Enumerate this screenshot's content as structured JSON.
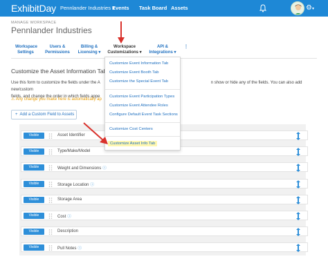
{
  "topbar": {
    "logo": "ExhibitDay",
    "org_selector": "Pennlander Industries",
    "nav": [
      "Events",
      "Task Board",
      "Assets"
    ]
  },
  "header": {
    "breadcrumb": "MANAGE WORKSPACE",
    "title": "Pennlander Industries"
  },
  "subnav": {
    "items": [
      {
        "line1": "Workspace",
        "line2": "Settings"
      },
      {
        "line1": "Users &",
        "line2": "Permissions"
      },
      {
        "line1": "Billing &",
        "line2": "Licensing"
      },
      {
        "line1": "Workspace",
        "line2": "Customizations"
      },
      {
        "line1": "API &",
        "line2": "Integrations"
      }
    ]
  },
  "dropdown": {
    "items": [
      "Customize Event Information Tab",
      "Customize Event Booth Tab",
      "Customize the Special Event Tab",
      "Customize Event Participation Types",
      "Customize Event Attendee Roles",
      "Configure Default Event Task Sections",
      "Customize Cost Centers",
      "Customize Asset Info Tab"
    ]
  },
  "main": {
    "section_title": "Customize the Asset Information Tab",
    "help_line1": "Use this form to customize the fields under the A",
    "help_line1_end": "n show or hide any of the fields. You can also add new/custom",
    "help_line2": "fields, and change the order in which fields appe",
    "warning": "Any change you make here is automatically ap",
    "add_button": "Add a Custom Field to Assets",
    "visible_label": "Visible",
    "fields": [
      "Asset Identifier",
      "Type/Make/Model",
      "Weight and Dimensions",
      "Storage Location",
      "Storage Area",
      "Cost",
      "Description",
      "Pull Notes"
    ]
  },
  "colors": {
    "brand_blue": "#1e88d6",
    "link_blue": "#1e6fbf",
    "warning_orange": "#e69a00",
    "annotation_red": "#d9312b",
    "highlight_yellow": "#fff7b0"
  }
}
